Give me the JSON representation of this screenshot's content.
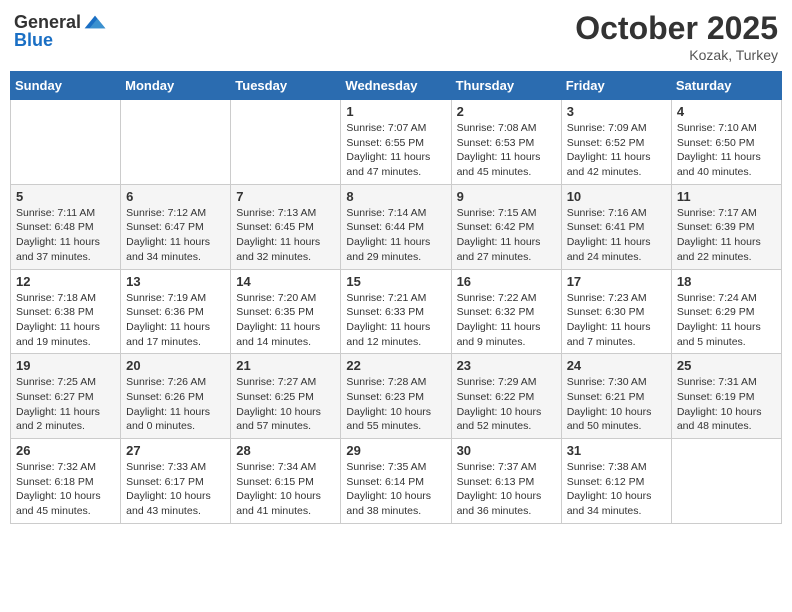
{
  "header": {
    "logo_general": "General",
    "logo_blue": "Blue",
    "month_year": "October 2025",
    "location": "Kozak, Turkey"
  },
  "weekdays": [
    "Sunday",
    "Monday",
    "Tuesday",
    "Wednesday",
    "Thursday",
    "Friday",
    "Saturday"
  ],
  "weeks": [
    [
      {
        "day": "",
        "info": ""
      },
      {
        "day": "",
        "info": ""
      },
      {
        "day": "",
        "info": ""
      },
      {
        "day": "1",
        "info": "Sunrise: 7:07 AM\nSunset: 6:55 PM\nDaylight: 11 hours and 47 minutes."
      },
      {
        "day": "2",
        "info": "Sunrise: 7:08 AM\nSunset: 6:53 PM\nDaylight: 11 hours and 45 minutes."
      },
      {
        "day": "3",
        "info": "Sunrise: 7:09 AM\nSunset: 6:52 PM\nDaylight: 11 hours and 42 minutes."
      },
      {
        "day": "4",
        "info": "Sunrise: 7:10 AM\nSunset: 6:50 PM\nDaylight: 11 hours and 40 minutes."
      }
    ],
    [
      {
        "day": "5",
        "info": "Sunrise: 7:11 AM\nSunset: 6:48 PM\nDaylight: 11 hours and 37 minutes."
      },
      {
        "day": "6",
        "info": "Sunrise: 7:12 AM\nSunset: 6:47 PM\nDaylight: 11 hours and 34 minutes."
      },
      {
        "day": "7",
        "info": "Sunrise: 7:13 AM\nSunset: 6:45 PM\nDaylight: 11 hours and 32 minutes."
      },
      {
        "day": "8",
        "info": "Sunrise: 7:14 AM\nSunset: 6:44 PM\nDaylight: 11 hours and 29 minutes."
      },
      {
        "day": "9",
        "info": "Sunrise: 7:15 AM\nSunset: 6:42 PM\nDaylight: 11 hours and 27 minutes."
      },
      {
        "day": "10",
        "info": "Sunrise: 7:16 AM\nSunset: 6:41 PM\nDaylight: 11 hours and 24 minutes."
      },
      {
        "day": "11",
        "info": "Sunrise: 7:17 AM\nSunset: 6:39 PM\nDaylight: 11 hours and 22 minutes."
      }
    ],
    [
      {
        "day": "12",
        "info": "Sunrise: 7:18 AM\nSunset: 6:38 PM\nDaylight: 11 hours and 19 minutes."
      },
      {
        "day": "13",
        "info": "Sunrise: 7:19 AM\nSunset: 6:36 PM\nDaylight: 11 hours and 17 minutes."
      },
      {
        "day": "14",
        "info": "Sunrise: 7:20 AM\nSunset: 6:35 PM\nDaylight: 11 hours and 14 minutes."
      },
      {
        "day": "15",
        "info": "Sunrise: 7:21 AM\nSunset: 6:33 PM\nDaylight: 11 hours and 12 minutes."
      },
      {
        "day": "16",
        "info": "Sunrise: 7:22 AM\nSunset: 6:32 PM\nDaylight: 11 hours and 9 minutes."
      },
      {
        "day": "17",
        "info": "Sunrise: 7:23 AM\nSunset: 6:30 PM\nDaylight: 11 hours and 7 minutes."
      },
      {
        "day": "18",
        "info": "Sunrise: 7:24 AM\nSunset: 6:29 PM\nDaylight: 11 hours and 5 minutes."
      }
    ],
    [
      {
        "day": "19",
        "info": "Sunrise: 7:25 AM\nSunset: 6:27 PM\nDaylight: 11 hours and 2 minutes."
      },
      {
        "day": "20",
        "info": "Sunrise: 7:26 AM\nSunset: 6:26 PM\nDaylight: 11 hours and 0 minutes."
      },
      {
        "day": "21",
        "info": "Sunrise: 7:27 AM\nSunset: 6:25 PM\nDaylight: 10 hours and 57 minutes."
      },
      {
        "day": "22",
        "info": "Sunrise: 7:28 AM\nSunset: 6:23 PM\nDaylight: 10 hours and 55 minutes."
      },
      {
        "day": "23",
        "info": "Sunrise: 7:29 AM\nSunset: 6:22 PM\nDaylight: 10 hours and 52 minutes."
      },
      {
        "day": "24",
        "info": "Sunrise: 7:30 AM\nSunset: 6:21 PM\nDaylight: 10 hours and 50 minutes."
      },
      {
        "day": "25",
        "info": "Sunrise: 7:31 AM\nSunset: 6:19 PM\nDaylight: 10 hours and 48 minutes."
      }
    ],
    [
      {
        "day": "26",
        "info": "Sunrise: 7:32 AM\nSunset: 6:18 PM\nDaylight: 10 hours and 45 minutes."
      },
      {
        "day": "27",
        "info": "Sunrise: 7:33 AM\nSunset: 6:17 PM\nDaylight: 10 hours and 43 minutes."
      },
      {
        "day": "28",
        "info": "Sunrise: 7:34 AM\nSunset: 6:15 PM\nDaylight: 10 hours and 41 minutes."
      },
      {
        "day": "29",
        "info": "Sunrise: 7:35 AM\nSunset: 6:14 PM\nDaylight: 10 hours and 38 minutes."
      },
      {
        "day": "30",
        "info": "Sunrise: 7:37 AM\nSunset: 6:13 PM\nDaylight: 10 hours and 36 minutes."
      },
      {
        "day": "31",
        "info": "Sunrise: 7:38 AM\nSunset: 6:12 PM\nDaylight: 10 hours and 34 minutes."
      },
      {
        "day": "",
        "info": ""
      }
    ]
  ]
}
